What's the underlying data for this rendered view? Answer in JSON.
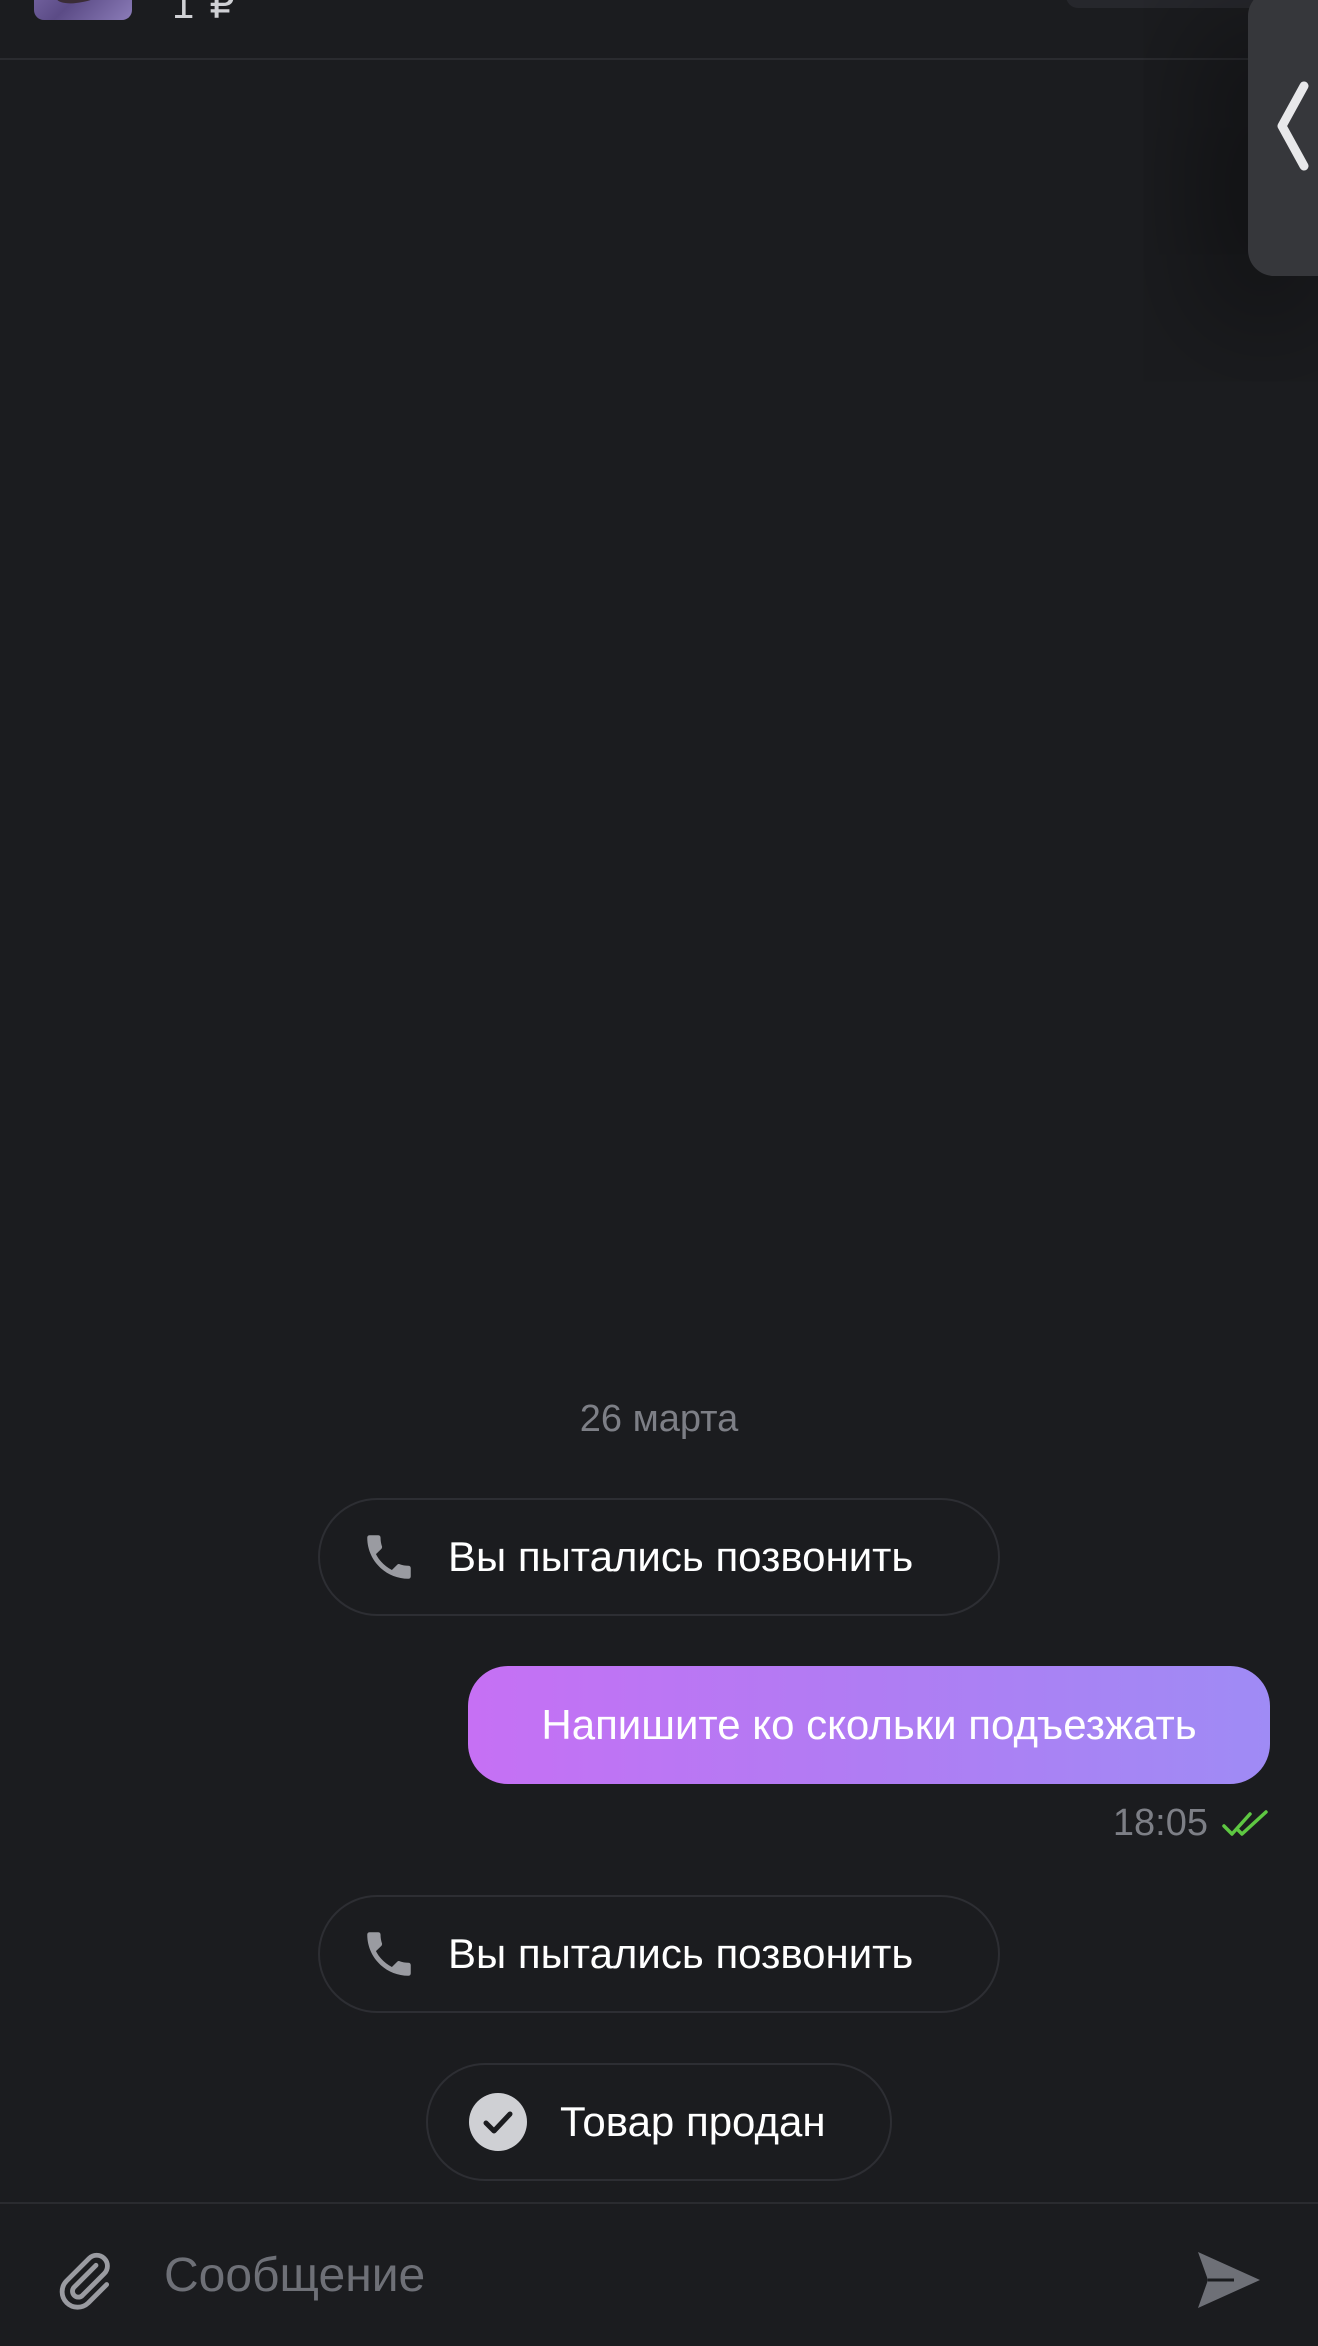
{
  "header": {
    "price_text": "1 ₽"
  },
  "chat": {
    "date_separator": "26 марта",
    "events": [
      {
        "type": "call",
        "label": "Вы пытались позвонить"
      },
      {
        "type": "message",
        "text": "Напишите ко скольки подъезжать",
        "time": "18:05",
        "status": "read"
      },
      {
        "type": "call",
        "label": "Вы пытались позвонить"
      },
      {
        "type": "status",
        "label": "Товар продан"
      }
    ]
  },
  "composer": {
    "placeholder": "Сообщение"
  },
  "icons": {
    "back": "chevron-left-icon",
    "call": "phone-icon",
    "sold": "check-circle-icon",
    "read": "double-check-icon",
    "attach": "paperclip-icon",
    "send": "send-icon"
  },
  "colors": {
    "background": "#1b1c1f",
    "bubble_start": "#c670f4",
    "bubble_end": "#9f8bf5",
    "read_check": "#5ec742",
    "muted_text": "#7d7f86"
  }
}
